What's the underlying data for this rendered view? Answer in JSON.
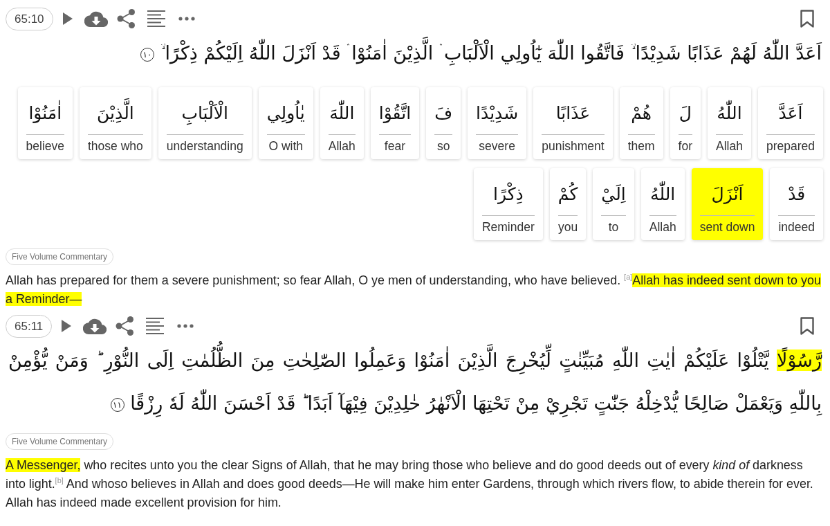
{
  "verses": [
    {
      "number": "65:10",
      "arabic": [
        {
          "text": "اَعَدَّ اللّٰهُ لَهُمْ عَذَابًا شَدِيْدًا ۙ فَاتَّقُوا اللّٰهَ يٰٓاُولِي الْاَلْبَابِ ۛ الَّذِيْنَ اٰمَنُوْا ۛ قَدْ اَنْزَلَ اللّٰهُ اِلَيْكُمْ ذِكْرًا ۙ",
          "highlighted": false
        }
      ],
      "end_marker": "١٠",
      "words": [
        {
          "arabic": "اَعَدَّ",
          "meaning": "prepared",
          "selected": false
        },
        {
          "arabic": "اللّٰهُ",
          "meaning": "Allah",
          "selected": false
        },
        {
          "arabic": "لَ",
          "meaning": "for",
          "selected": false
        },
        {
          "arabic": "هُمْ",
          "meaning": "them",
          "selected": false
        },
        {
          "arabic": "عَذَابًا",
          "meaning": "punishment",
          "selected": false
        },
        {
          "arabic": "شَدِيْدًا",
          "meaning": "severe",
          "selected": false
        },
        {
          "arabic": "فَ",
          "meaning": "so",
          "selected": false
        },
        {
          "arabic": "اتَّقُوْا",
          "meaning": "fear",
          "selected": false
        },
        {
          "arabic": "اللّٰهَ",
          "meaning": "Allah",
          "selected": false
        },
        {
          "arabic": "يٰاُولِي",
          "meaning": "O with",
          "selected": false
        },
        {
          "arabic": "الْاَلْبَابِ",
          "meaning": "understanding",
          "selected": false
        },
        {
          "arabic": "الَّذِيْنَ",
          "meaning": "those who",
          "selected": false
        },
        {
          "arabic": "اٰمَنُوْا",
          "meaning": "believe",
          "selected": false
        },
        {
          "arabic": "قَدْ",
          "meaning": "indeed",
          "selected": false
        },
        {
          "arabic": "اَنْزَلَ",
          "meaning": "sent down",
          "selected": true
        },
        {
          "arabic": "اللّٰهُ",
          "meaning": "Allah",
          "selected": false
        },
        {
          "arabic": "اِلَيْ",
          "meaning": "to",
          "selected": false
        },
        {
          "arabic": "كُمْ",
          "meaning": "you",
          "selected": false
        },
        {
          "arabic": "ذِكْرًا",
          "meaning": "Reminder",
          "selected": false
        }
      ],
      "commentary_button": "Five Volume Commentary",
      "translation": [
        {
          "text": "Allah has prepared for them a severe punishment; so fear Allah, O ye men of understanding, who have believed. $^{[a]}$",
          "highlighted": false
        },
        {
          "text": "Allah has indeed sent down to you a Reminder—",
          "highlighted": true
        }
      ]
    },
    {
      "number": "65:11",
      "arabic": [
        {
          "text": "رَّسُوْلًا",
          "highlighted": true
        },
        {
          "text": "يَّتْلُوْا عَلَيْكُمْ اٰيٰتِ اللّٰهِ مُبَيِّنٰتٍ لِّيُخْرِجَ الَّذِيْنَ اٰمَنُوْا وَعَمِلُوا الصّٰلِحٰتِ مِنَ الظُّلُمٰتِ اِلَى النُّوْرِ ؕ وَمَنْ يُّؤْمِنْ بِاللّٰهِ وَيَعْمَلْ صَالِحًا يُّدْخِلْهُ جَنّٰتٍ تَجْرِيْ مِنْ تَحْتِهَا الْاَنْهٰرُ خٰلِدِيْنَ فِيْهَآ اَبَدًا ؕ قَدْ اَحْسَنَ اللّٰهُ لَهٗ رِزْقًا",
          "highlighted": false
        }
      ],
      "end_marker": "١١",
      "commentary_button": "Five Volume Commentary",
      "translation": [
        {
          "text": "A Messenger,",
          "highlighted": true
        },
        {
          "text": " who recites unto you the clear Signs of Allah, that he may bring those who believe and do good deeds out of every *kind of* darkness into light.$^{[b]}$ And whoso believes in Allah and does good deeds—He will make him enter Gardens, through which rivers flow, to abide therein for ever. Allah has indeed made excellent provision for him.",
          "highlighted": false
        }
      ]
    }
  ]
}
